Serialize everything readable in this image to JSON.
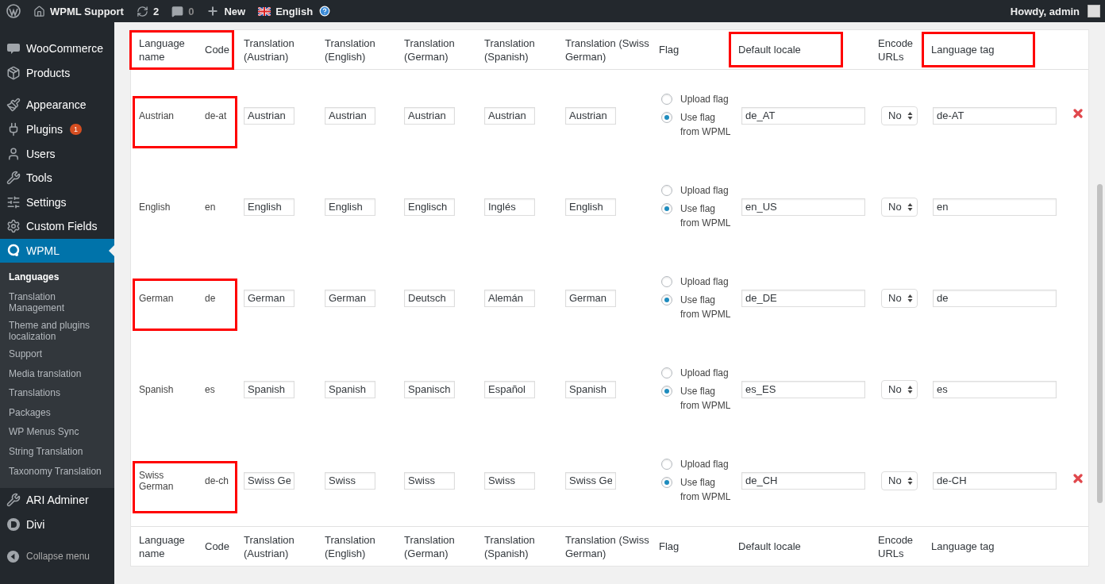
{
  "admin_bar": {
    "site": "WPML Support",
    "updates": "2",
    "comments": "0",
    "new": "New",
    "language": "English",
    "account": "Howdy, admin"
  },
  "sidebar": {
    "groups": [
      [
        {
          "label": "WooCommerce",
          "selected": false
        },
        {
          "label": "Products",
          "selected": false
        }
      ],
      [
        {
          "label": "Appearance",
          "selected": false
        },
        {
          "label": "Plugins",
          "selected": false,
          "badge": "1"
        },
        {
          "label": "Users",
          "selected": false
        },
        {
          "label": "Tools",
          "selected": false
        },
        {
          "label": "Settings",
          "selected": false
        },
        {
          "label": "Custom Fields",
          "selected": false
        },
        {
          "label": "WPML",
          "selected": true,
          "submenu": [
            {
              "label": "Languages",
              "selected": true
            },
            {
              "label": "Translation Management",
              "selected": false
            },
            {
              "label": "Theme and plugins localization",
              "selected": false
            },
            {
              "label": "Support",
              "selected": false
            },
            {
              "label": "Media translation",
              "selected": false
            },
            {
              "label": "Translations",
              "selected": false
            },
            {
              "label": "Packages",
              "selected": false
            },
            {
              "label": "WP Menus Sync",
              "selected": false
            },
            {
              "label": "String Translation",
              "selected": false
            },
            {
              "label": "Taxonomy Translation",
              "selected": false
            }
          ]
        },
        {
          "label": "ARI Adminer",
          "selected": false
        },
        {
          "label": "Divi",
          "selected": false
        }
      ]
    ],
    "collapse": "Collapse menu"
  },
  "table": {
    "columns": [
      {
        "labels": [
          "Language name",
          "Code"
        ],
        "highlighted": true
      },
      {
        "labels": [
          "Translation (Austrian)"
        ],
        "highlighted": false
      },
      {
        "labels": [
          "Translation (English)"
        ],
        "highlighted": false
      },
      {
        "labels": [
          "Translation (German)"
        ],
        "highlighted": false
      },
      {
        "labels": [
          "Translation (Spanish)"
        ],
        "highlighted": false
      },
      {
        "labels": [
          "Translation (Swiss German)"
        ],
        "highlighted": false
      },
      {
        "labels": [
          "Flag"
        ],
        "highlighted": false
      },
      {
        "labels": [
          "Default locale"
        ],
        "highlighted": true
      },
      {
        "labels": [
          "Encode URLs"
        ],
        "highlighted": false
      },
      {
        "labels": [
          "Language tag"
        ],
        "highlighted": true
      }
    ],
    "rows": [
      {
        "name": "Austrian",
        "code": "de-at",
        "translations": [
          "Austrian",
          "Austrian",
          "Austrian",
          "Austrian",
          "Austrian"
        ],
        "flag_options": [
          {
            "label": "Upload flag",
            "selected": false
          },
          {
            "label": "Use flag from WPML",
            "selected": true
          }
        ],
        "locale": "de_AT",
        "encode": "No",
        "tag": "de-AT",
        "deletable": true,
        "highlighted": true
      },
      {
        "name": "English",
        "code": "en",
        "translations": [
          "English",
          "English",
          "Englisch",
          "Inglés",
          "English"
        ],
        "flag_options": [
          {
            "label": "Upload flag",
            "selected": false
          },
          {
            "label": "Use flag from WPML",
            "selected": true
          }
        ],
        "locale": "en_US",
        "encode": "No",
        "tag": "en",
        "deletable": false,
        "highlighted": false
      },
      {
        "name": "German",
        "code": "de",
        "translations": [
          "German",
          "German",
          "Deutsch",
          "Alemán",
          "German"
        ],
        "flag_options": [
          {
            "label": "Upload flag",
            "selected": false
          },
          {
            "label": "Use flag from WPML",
            "selected": true
          }
        ],
        "locale": "de_DE",
        "encode": "No",
        "tag": "de",
        "deletable": false,
        "highlighted": true
      },
      {
        "name": "Spanish",
        "code": "es",
        "translations": [
          "Spanish",
          "Spanish",
          "Spanisch",
          "Español",
          "Spanish"
        ],
        "flag_options": [
          {
            "label": "Upload flag",
            "selected": false
          },
          {
            "label": "Use flag from WPML",
            "selected": true
          }
        ],
        "locale": "es_ES",
        "encode": "No",
        "tag": "es",
        "deletable": false,
        "highlighted": false
      },
      {
        "name": "Swiss German",
        "code": "de-ch",
        "translations": [
          "Swiss Ge",
          "Swiss",
          "Swiss",
          "Swiss",
          "Swiss Ge"
        ],
        "flag_options": [
          {
            "label": "Upload flag",
            "selected": false
          },
          {
            "label": "Use flag from WPML",
            "selected": true
          }
        ],
        "locale": "de_CH",
        "encode": "No",
        "tag": "de-CH",
        "deletable": true,
        "highlighted": true
      }
    ],
    "footer": [
      [
        "Language name",
        "Code"
      ],
      [
        "Translation (Austrian)"
      ],
      [
        "Translation (English)"
      ],
      [
        "Translation (German)"
      ],
      [
        "Translation (Spanish)"
      ],
      [
        "Translation (Swiss German)"
      ],
      [
        "Flag"
      ],
      [
        "Default locale"
      ],
      [
        "Encode URLs"
      ],
      [
        "Language tag"
      ]
    ]
  }
}
